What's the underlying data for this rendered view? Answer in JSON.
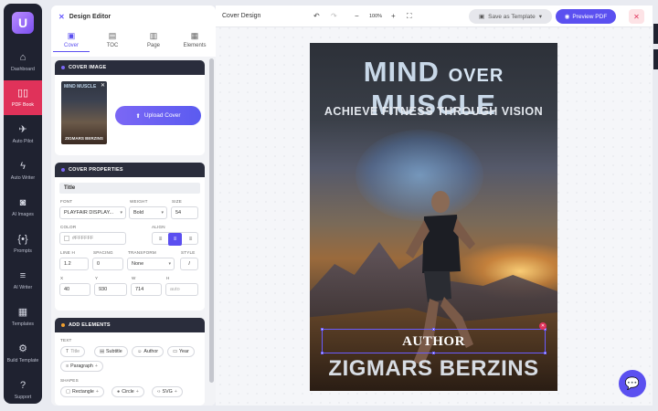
{
  "sidebar": {
    "logo": "U",
    "items": [
      {
        "label": "Dashboard",
        "icon": "home-icon",
        "glyph": "⌂"
      },
      {
        "label": "PDF Book",
        "icon": "book-icon",
        "glyph": "▯▯"
      },
      {
        "label": "Auto Pilot",
        "icon": "rocket-icon",
        "glyph": "✈"
      },
      {
        "label": "Auto Writer",
        "icon": "bolt-icon",
        "glyph": "ϟ"
      },
      {
        "label": "AI Images",
        "icon": "camera-icon",
        "glyph": "◙"
      },
      {
        "label": "Prompts",
        "icon": "braces-icon",
        "glyph": "{•}"
      },
      {
        "label": "AI Writer",
        "icon": "writer-icon",
        "glyph": "≡"
      },
      {
        "label": "Templates",
        "icon": "grid-icon",
        "glyph": "▦"
      },
      {
        "label": "Build Template",
        "icon": "gear-icon",
        "glyph": "⚙"
      },
      {
        "label": "Support",
        "icon": "help-icon",
        "glyph": "?"
      }
    ]
  },
  "editor": {
    "title": "Design Editor",
    "tabs": [
      {
        "label": "Cover",
        "glyph": "▣"
      },
      {
        "label": "TOC",
        "glyph": "▤"
      },
      {
        "label": "Page",
        "glyph": "▥"
      },
      {
        "label": "Elements",
        "glyph": "▦"
      }
    ],
    "cover_image": {
      "header": "COVER IMAGE",
      "upload_label": "Upload Cover",
      "thumb_top": "MIND MUSCLE",
      "thumb_bottom": "ZIGMARS BERZINS"
    },
    "properties": {
      "header": "COVER PROPERTIES",
      "section": "Title",
      "font_label": "FONT",
      "font_value": "PLAYFAIR DISPLAY...",
      "weight_label": "WEIGHT",
      "weight_value": "Bold",
      "size_label": "SIZE",
      "size_value": "54",
      "color_label": "COLOR",
      "color_value": "#FFFFFF",
      "align_label": "ALIGN",
      "lineh_label": "LINE H",
      "lineh_value": "1.2",
      "spacing_label": "SPACING",
      "spacing_value": "0",
      "transform_label": "TRANSFORM",
      "transform_value": "None",
      "style_label": "STYLE",
      "style_value": "I",
      "x_label": "X",
      "x_value": "40",
      "y_label": "Y",
      "y_value": "930",
      "w_label": "W",
      "w_value": "714",
      "h_label": "H",
      "h_placeholder": "auto"
    },
    "add_elements": {
      "header": "ADD ELEMENTS",
      "text_label": "TEXT",
      "text_items": [
        "Title",
        "Subtitle",
        "Author",
        "Year",
        "Paragraph"
      ],
      "shapes_label": "SHAPES",
      "shape_items": [
        "Rectangle",
        "Circle",
        "SVG"
      ]
    }
  },
  "canvas": {
    "title": "Cover Design",
    "zoom": "100%",
    "save_template": "Save as Template",
    "preview": "Preview PDF",
    "cover": {
      "title_line1_a": "MIND",
      "title_line1_b": "OVER",
      "title_line1_c": "MUSCLE",
      "subtitle": "ACHIEVE FITNESS THROUGH VISION",
      "author_label": "AUTHOR",
      "author_name": "ZIGMARS BERZINS"
    }
  },
  "colors": {
    "accent": "#5b4ff0",
    "active_nav": "#e0325a",
    "rail": "#1f2230",
    "header": "#2a2d3c"
  }
}
